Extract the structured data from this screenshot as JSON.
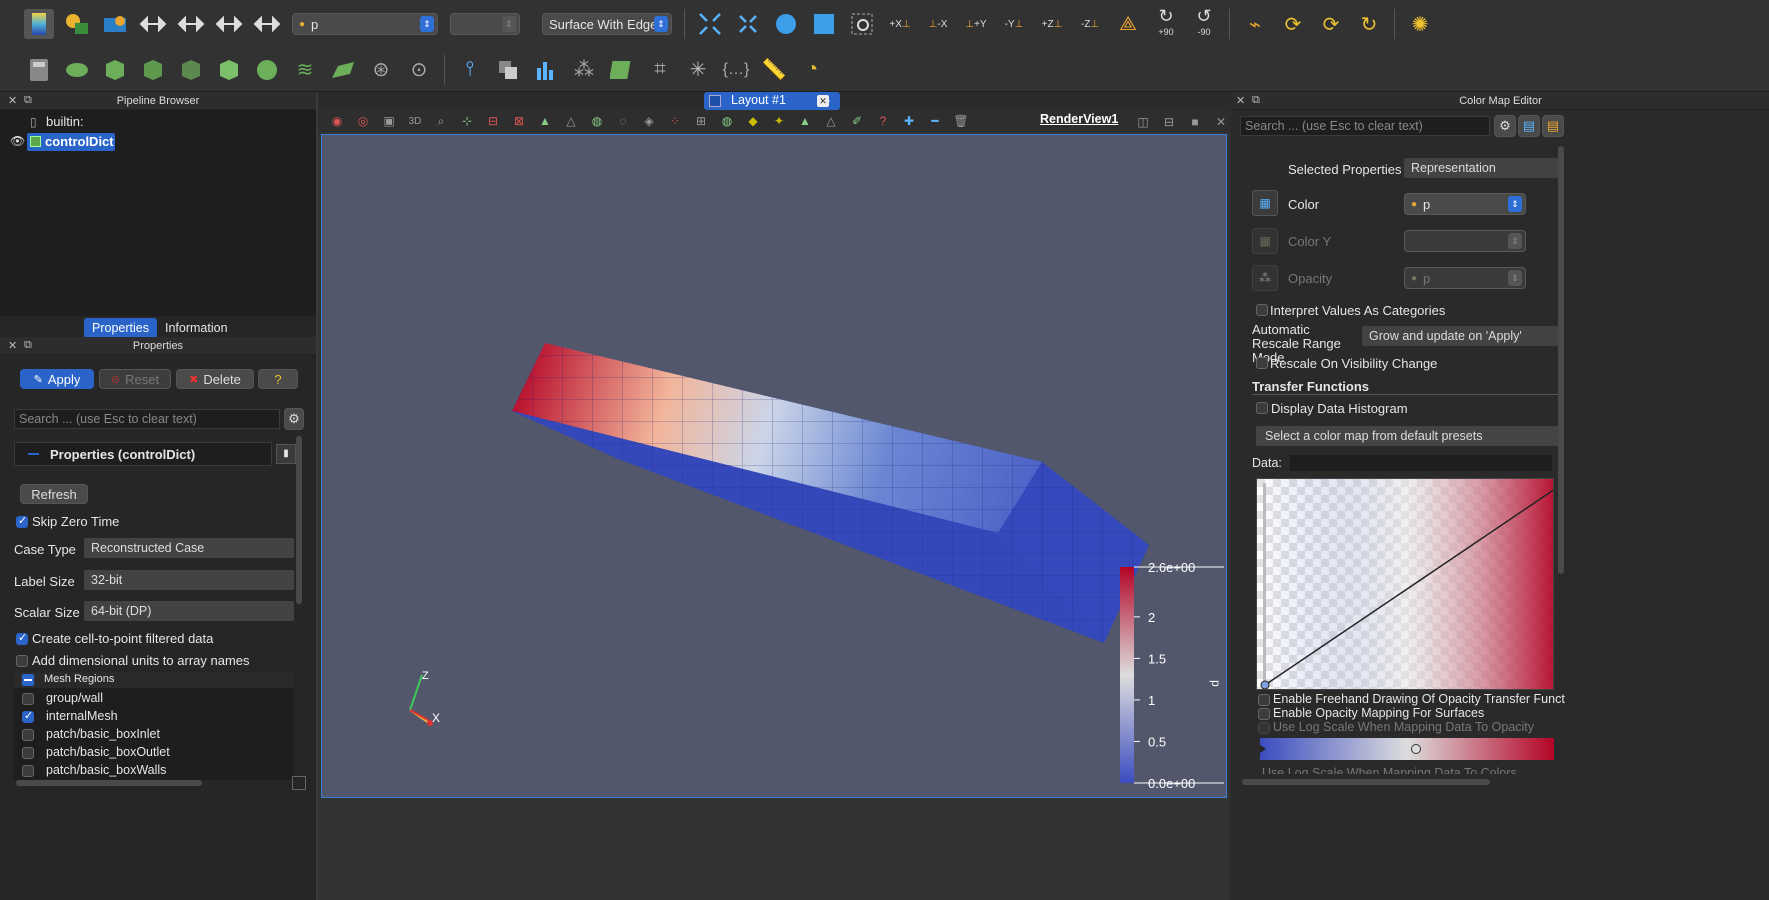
{
  "toolbar1": {
    "array_combo": "p",
    "time_combo": "",
    "representation_combo": "Surface With Edges",
    "icons": [
      "color-map-icon",
      "color-palette-icon",
      "rescale-icon",
      "reset-range-icon",
      "rescale-custom-icon",
      "rescale-visible-icon",
      "rescale-temporal-icon"
    ],
    "camera_labels": [
      "+X",
      "-X",
      "+Y",
      "-Y",
      "+Z",
      "-Z"
    ],
    "rotate_plus": "+90",
    "rotate_minus": "-90"
  },
  "pipeline": {
    "title": "Pipeline Browser",
    "builtin": "builtin:",
    "source": "controlDict"
  },
  "prop_tabs": {
    "properties": "Properties",
    "information": "Information"
  },
  "properties": {
    "title": "Properties",
    "apply": "Apply",
    "reset": "Reset",
    "delete": "Delete",
    "help": "?",
    "search_placeholder": "Search ... (use Esc to clear text)",
    "section_title": "Properties (controlDict)",
    "refresh": "Refresh",
    "skip_zero_time": "Skip Zero Time",
    "case_type_label": "Case Type",
    "case_type_value": "Reconstructed Case",
    "label_size_label": "Label Size",
    "label_size_value": "32-bit",
    "scalar_size_label": "Scalar Size",
    "scalar_size_value": "64-bit (DP)",
    "create_cell_to_point": "Create cell-to-point filtered data",
    "add_dim_units": "Add dimensional units to array names",
    "mesh_regions_header": "Mesh Regions",
    "mesh_regions": [
      {
        "name": "group/wall",
        "checked": false
      },
      {
        "name": "internalMesh",
        "checked": true
      },
      {
        "name": "patch/basic_boxInlet",
        "checked": false
      },
      {
        "name": "patch/basic_boxOutlet",
        "checked": false
      },
      {
        "name": "patch/basic_boxWalls",
        "checked": false
      }
    ]
  },
  "layout": {
    "tab": "Layout #1",
    "add": "+",
    "render_view": "RenderView1",
    "btn_3d": "3D"
  },
  "colorbar": {
    "title": "p",
    "labels": [
      "2.6e+00",
      "2",
      "1.5",
      "1",
      "0.5",
      "0.0e+00"
    ],
    "min": 0.0,
    "max": 2.6
  },
  "axes": {
    "z": "Z",
    "x": "X"
  },
  "cme": {
    "title": "Color Map Editor",
    "search_placeholder": "Search ... (use Esc to clear text)",
    "selected_properties_label": "Selected Properties",
    "selected_properties_value": "Representation",
    "color_label": "Color",
    "color_value": "p",
    "color_y_label": "Color Y",
    "opacity_label": "Opacity",
    "opacity_value": "p",
    "interpret_categories": "Interpret Values As Categories",
    "auto_rescale_label": "Automatic Rescale Range Mode",
    "auto_rescale_value": "Grow and update on 'Apply'",
    "rescale_visibility": "Rescale On Visibility Change",
    "transfer_functions": "Transfer Functions",
    "display_histogram": "Display Data Histogram",
    "preset_button": "Select a color map from default presets",
    "data_label": "Data:",
    "freehand": "Enable Freehand Drawing Of Opacity Transfer Funct",
    "opacity_mapping": "Enable Opacity Mapping For Surfaces",
    "log_scale_opacity": "Use Log Scale When Mapping Data To Opacity",
    "log_scale_colors": "Use Log Scale When Mapping Data To Colors"
  },
  "colors": {
    "accent": "#2a64c9",
    "view_bg": "#52576b",
    "cool": "#3b4cc0",
    "warm": "#b40426"
  }
}
